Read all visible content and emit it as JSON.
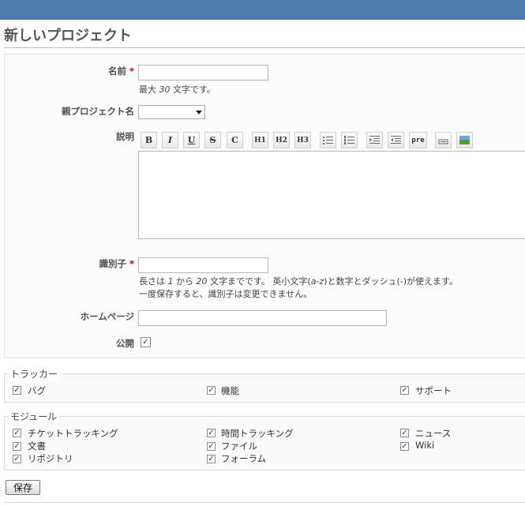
{
  "page": {
    "title": "新しいプロジェクト"
  },
  "form": {
    "name": {
      "label": "名前",
      "required_mark": "*",
      "value": "",
      "hint_prefix": "最大 ",
      "hint_num": "30",
      "hint_suffix": " 文字です。"
    },
    "parent": {
      "label": "親プロジェクト名",
      "value": ""
    },
    "description": {
      "label": "説明",
      "value": ""
    },
    "identifier": {
      "label": "識別子",
      "required_mark": "*",
      "value": "",
      "hint1_a": "長さは ",
      "hint1_b": "1",
      "hint1_c": " から ",
      "hint1_d": "20",
      "hint1_e": " 文字までです。 英小文字(",
      "hint1_f": "a-z",
      "hint1_g": ")と数字とダッシュ(",
      "hint1_h": "-",
      "hint1_i": ")が使えます。",
      "hint2": "一度保存すると、識別子は変更できません。"
    },
    "homepage": {
      "label": "ホームページ",
      "value": ""
    },
    "public": {
      "label": "公開",
      "checked": true
    }
  },
  "toolbar": {
    "bold": "B",
    "italic": "I",
    "underline": "U",
    "strike": "S",
    "code": "C",
    "h1": "H1",
    "h2": "H2",
    "h3": "H3",
    "pre": "pre"
  },
  "trackers": {
    "legend": "トラッカー",
    "items": [
      {
        "label": "バグ",
        "checked": true
      },
      {
        "label": "機能",
        "checked": true
      },
      {
        "label": "サポート",
        "checked": true
      }
    ]
  },
  "modules": {
    "legend": "モジュール",
    "items": [
      {
        "label": "チケットトラッキング",
        "checked": true
      },
      {
        "label": "時間トラッキング",
        "checked": true
      },
      {
        "label": "ニュース",
        "checked": true
      },
      {
        "label": "文書",
        "checked": true
      },
      {
        "label": "ファイル",
        "checked": true
      },
      {
        "label": "Wiki",
        "checked": true
      },
      {
        "label": "リポジトリ",
        "checked": true
      },
      {
        "label": "フォーラム",
        "checked": true
      }
    ]
  },
  "actions": {
    "save": "保存"
  },
  "checkmark": "✓",
  "colors": {
    "header": "#507aaa",
    "required": "#bb0000"
  }
}
